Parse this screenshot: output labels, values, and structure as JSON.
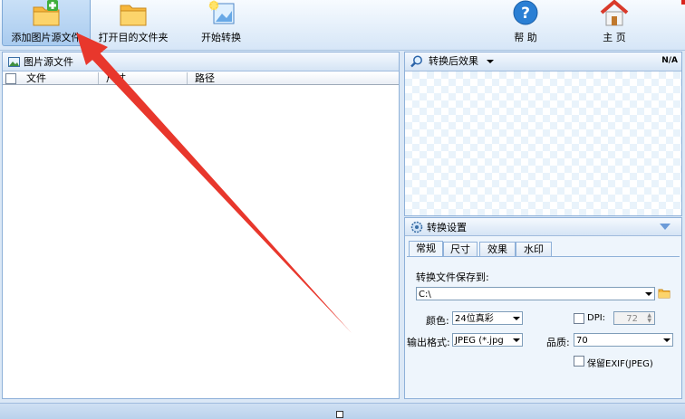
{
  "toolbar": {
    "add_source": "添加图片源文件",
    "open_target": "打开目的文件夹",
    "start_convert": "开始转换",
    "help": "帮 助",
    "home": "主 页"
  },
  "source_panel": {
    "title": "图片源文件",
    "columns": [
      "文件",
      "尺寸",
      "路径"
    ]
  },
  "preview_panel": {
    "mode": "转换后效果",
    "size_readout": "N/A"
  },
  "settings_panel": {
    "title": "转换设置",
    "tabs": [
      "常规",
      "尺寸",
      "效果",
      "水印"
    ],
    "save_to_label": "转换文件保存到:",
    "save_path": "C:\\",
    "color_label": "颜色:",
    "color_value": "24位真彩",
    "dpi_label": "DPI:",
    "dpi_value": "72",
    "format_label": "输出格式:",
    "format_value": "JPEG (*.jpg",
    "quality_label": "品质:",
    "quality_value": "70",
    "exif_label": "保留EXIF(JPEG)"
  },
  "colors": {
    "arrow": "#e8372c",
    "panel_border": "#8fb1d9"
  }
}
